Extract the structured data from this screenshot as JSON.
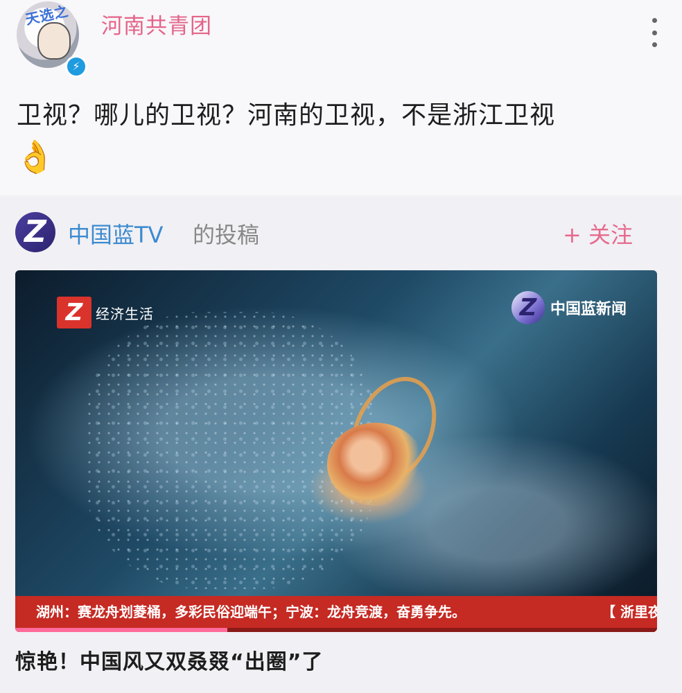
{
  "post": {
    "avatar_text": "天选之",
    "author": "河南共青团",
    "verified_icon": "lightning-icon",
    "menu_icon": "more-vertical-icon",
    "text": "卫视？哪儿的卫视？河南的卫视，不是浙江卫视",
    "emoji": "👌"
  },
  "repost": {
    "source_logo": "Z",
    "source_name": "中国蓝TV",
    "source_suffix": "的投稿",
    "follow_label": "+ 关注",
    "video": {
      "channel_left_logo": "Z",
      "channel_left": "经济生活",
      "channel_right_logo": "Z",
      "channel_right": "中国蓝新闻",
      "ticker": "湖州：赛龙舟划菱桶，多彩民俗迎端午；宁波：龙舟竞渡，奋勇争先。",
      "ticker_right": "【 浙里夜",
      "progress": 0.33
    },
    "caption": "惊艳！中国风又双叒叕“出圈”了"
  },
  "colors": {
    "author": "#e4648a",
    "follow": "#e66a8e",
    "source_name": "#3b8ad0",
    "ticker_bg": "#c52a23"
  }
}
